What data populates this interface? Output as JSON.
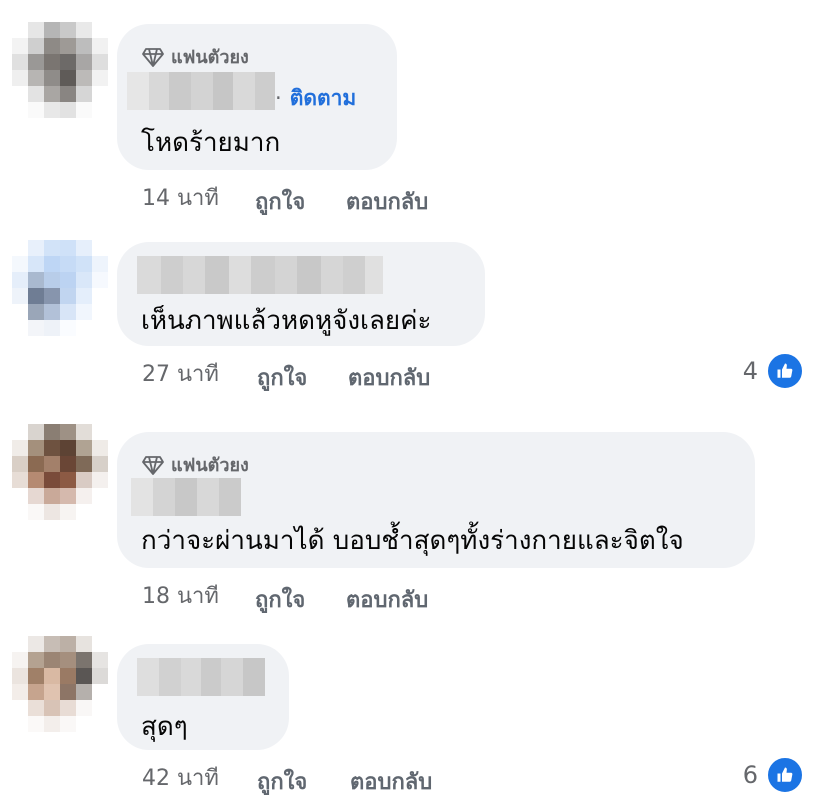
{
  "comments": [
    {
      "badge": "แฟนตัวยง",
      "follow": "ติดตาม",
      "dot": "·",
      "text": "โหดร้ายมาก",
      "time": "14 นาที",
      "like": "ถูกใจ",
      "reply": "ตอบกลับ",
      "reactions": ""
    },
    {
      "badge": "",
      "follow": "",
      "dot": "",
      "text": "เห็นภาพแล้วหดหูจังเลยค่ะ",
      "time": "27 นาที",
      "like": "ถูกใจ",
      "reply": "ตอบกลับ",
      "reactions": "4"
    },
    {
      "badge": "แฟนตัวยง",
      "follow": "",
      "dot": "",
      "text": "กว่าจะผ่านมาได้ บอบช้ำสุดๆทั้งร่างกายและจิตใจ",
      "time": "18 นาที",
      "like": "ถูกใจ",
      "reply": "ตอบกลับ",
      "reactions": ""
    },
    {
      "badge": "",
      "follow": "",
      "dot": "",
      "text": "สุดๆ",
      "time": "42 นาที",
      "like": "ถูกใจ",
      "reply": "ตอบกลับ",
      "reactions": "6"
    }
  ],
  "colors": {
    "bubble": "#f0f2f5",
    "link": "#216fdb",
    "meta": "#65676b",
    "like_badge": "#1b74e4"
  },
  "icons": [
    "diamond-fan-icon",
    "thumbs-up-icon"
  ]
}
